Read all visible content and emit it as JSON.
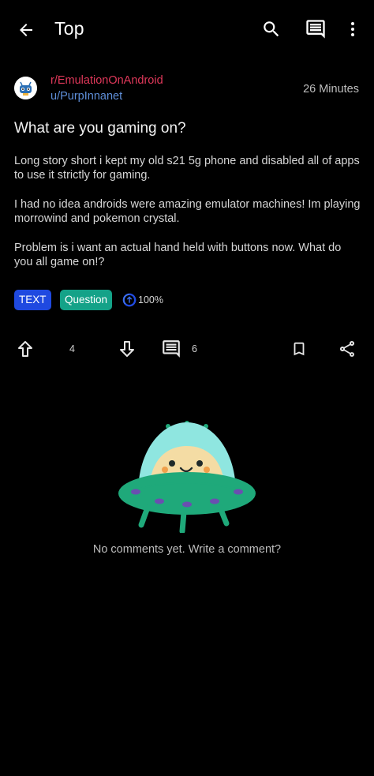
{
  "appbar": {
    "title": "Top",
    "icons": [
      "back-arrow-icon",
      "search-icon",
      "comments-icon",
      "more-vertical-icon"
    ]
  },
  "post": {
    "subreddit": "r/EmulationOnAndroid",
    "author": "u/PurpInnanet",
    "time": "26 Minutes",
    "title": "What are you gaming on?",
    "body": [
      "Long story short i kept my old s21 5g phone and disabled all of apps to use it strictly for gaming.",
      "I had no idea androids were amazing emulator machines! Im playing morrowind and pokemon crystal.",
      "Problem is i want an actual hand held with buttons now. What do you all game on!?"
    ],
    "tags": {
      "type": "TEXT",
      "flair": "Question"
    },
    "upvote_ratio": "100%",
    "score": "4",
    "comment_count": "6"
  },
  "empty_state": {
    "message": "No comments yet. Write a comment?"
  },
  "colors": {
    "background": "#000000",
    "subreddit": "#e0385a",
    "author": "#5f8fd9",
    "tag_text_bg": "#1f49e0",
    "tag_question_bg": "#14a288",
    "ufo_green": "#1fa97a",
    "ufo_dome": "#8fe6e0"
  }
}
